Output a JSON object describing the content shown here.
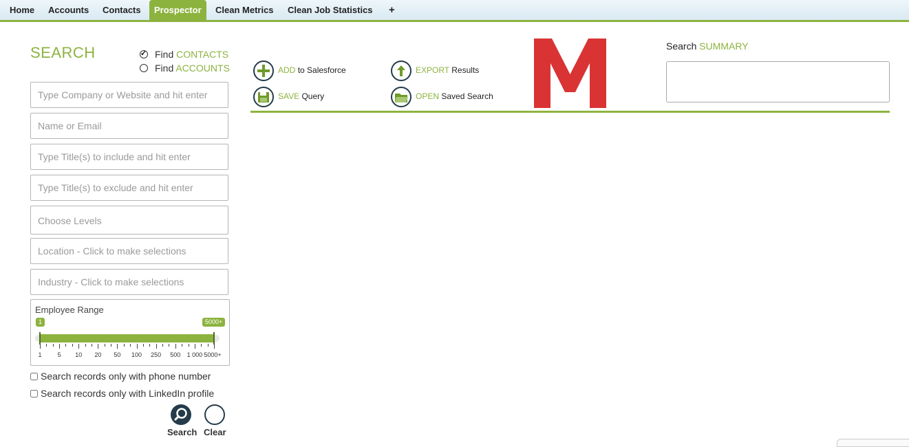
{
  "tabs": [
    "Home",
    "Accounts",
    "Contacts",
    "Prospector",
    "Clean Metrics",
    "Clean Job Statistics",
    "+"
  ],
  "active_tab": "Prospector",
  "search": {
    "title": "SEARCH",
    "find_contacts": {
      "prefix": "Find",
      "label": "CONTACTS",
      "checked": true
    },
    "find_accounts": {
      "prefix": "Find",
      "label": "ACCOUNTS",
      "checked": false
    },
    "placeholders": {
      "company": "Type Company or Website and hit enter",
      "name_email": "Name or Email",
      "title_include": "Type Title(s) to include and hit enter",
      "title_exclude": "Type Title(s) to exclude and hit enter",
      "levels": "Choose Levels",
      "location": "Location - Click to make selections",
      "industry": "Industry - Click to make selections"
    },
    "employee_range": {
      "label": "Employee Range",
      "min_value": "1",
      "max_value": "5000+",
      "ticks": [
        "1",
        "5",
        "10",
        "20",
        "50",
        "100",
        "250",
        "500",
        "1 000",
        "5000+"
      ]
    },
    "phone_checkbox": "Search records only with phone number",
    "linkedin_checkbox": "Search records only with LinkedIn profile",
    "search_button": "Search",
    "clear_button": "Clear"
  },
  "actions": {
    "add": {
      "accent": "ADD",
      "rest": "to Salesforce"
    },
    "save": {
      "accent": "SAVE",
      "rest": "Query"
    },
    "export": {
      "accent": "EXPORT",
      "rest": "Results"
    },
    "open": {
      "accent": "OPEN",
      "rest": "Saved Search"
    }
  },
  "summary": {
    "prefix": "Search",
    "accent": "SUMMARY"
  },
  "colors": {
    "accent": "#8db33f",
    "logo_red": "#d93333",
    "icon_dark": "#243b4a"
  },
  "icons": [
    "plus-icon",
    "floppy-disk-icon",
    "upload-arrow-icon",
    "folder-icon",
    "magnifier-icon",
    "m-logo"
  ]
}
